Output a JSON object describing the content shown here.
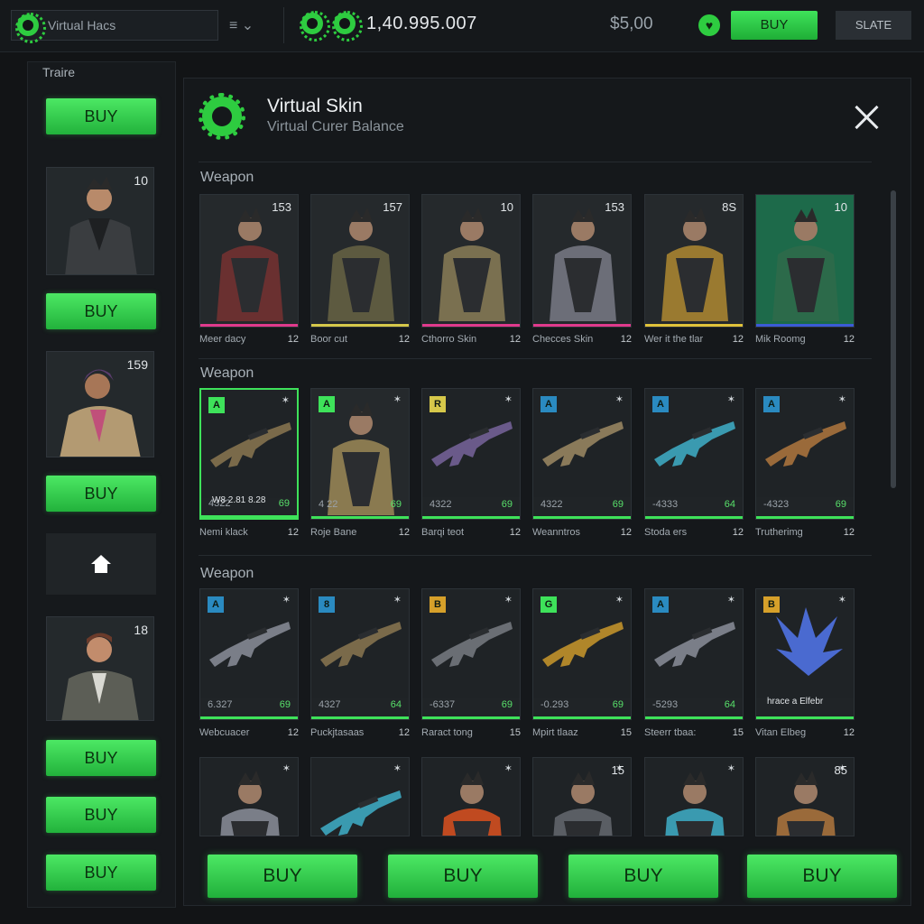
{
  "topbar": {
    "search_value": "Virtual Hacs",
    "menu_icon": "≡ ⌄",
    "balance": "1,40.995.007",
    "price": "$5,00",
    "buy_label": "BUY",
    "slate_label": "SLATE"
  },
  "sidebar": {
    "title": "Traire",
    "buy_label": "BUY",
    "cards": [
      {
        "num": "10"
      },
      {
        "num": "159"
      },
      {
        "num": "18"
      }
    ]
  },
  "panel": {
    "title": "Virtual Skin",
    "subtitle": "Virtual Curer Balance",
    "sections": [
      "Weapon",
      "Weapon",
      "Weapon"
    ]
  },
  "row1": [
    {
      "num": "153",
      "name": "Meer dacy",
      "count": "12",
      "bar": "#e03a8c"
    },
    {
      "num": "157",
      "name": "Boor cut",
      "count": "12",
      "bar": "#d6c84a"
    },
    {
      "num": "10",
      "name": "Cthorro Skin",
      "count": "12",
      "bar": "#e03a8c"
    },
    {
      "num": "153",
      "name": "Checces Skin",
      "count": "12",
      "bar": "#e03a8c"
    },
    {
      "num": "8S",
      "name": "Wer it the tlar",
      "count": "12",
      "bar": "#e0c23a"
    },
    {
      "num": "10",
      "name": "Mik Roomg",
      "count": "12",
      "bar": "#3b5bd6"
    }
  ],
  "row2": [
    {
      "tag": "A",
      "left": "4322",
      "right": "69",
      "name": "Nemi klack",
      "count": "12",
      "mid": "W8 2.81 8.28"
    },
    {
      "tag": "A",
      "left": "4 22",
      "right": "69",
      "name": "Roje Bane",
      "count": "12"
    },
    {
      "tag": "R",
      "left": "4322",
      "right": "69",
      "name": "Barqi teot",
      "count": "12"
    },
    {
      "tag": "A",
      "left": "4322",
      "right": "69",
      "name": "Weanntros",
      "count": "12"
    },
    {
      "tag": "A",
      "left": "-4333",
      "right": "64",
      "name": "Stoda ers",
      "count": "12"
    },
    {
      "tag": "A",
      "left": "-4323",
      "right": "69",
      "name": "Trutherimg",
      "count": "12"
    }
  ],
  "row3": [
    {
      "tag": "A",
      "left": "6.327",
      "right": "69",
      "name": "Webcuacer",
      "count": "12"
    },
    {
      "tag": "8",
      "left": "4327",
      "right": "64",
      "name": "Puckjtasaas",
      "count": "12"
    },
    {
      "tag": "B",
      "left": "-6337",
      "right": "69",
      "name": "Raract tong",
      "count": "15"
    },
    {
      "tag": "G",
      "left": "-0.293",
      "right": "69",
      "name": "Mpirt tlaaz",
      "count": "15"
    },
    {
      "tag": "A",
      "left": "-5293",
      "right": "64",
      "name": "Steerr tbaa:",
      "count": "15"
    },
    {
      "tag": "B",
      "left": "",
      "right": "",
      "name": "Vitan Elbeg",
      "count": "12",
      "mid": "hrace a Elfebr"
    }
  ],
  "row4": [
    {
      "num": ""
    },
    {
      "num": ""
    },
    {
      "num": ""
    },
    {
      "num": "15"
    },
    {
      "num": ""
    },
    {
      "num": "85"
    }
  ],
  "bottom": {
    "buy_label": "BUY"
  },
  "colors": {
    "accent": "#3ee25a",
    "background": "#121416"
  }
}
